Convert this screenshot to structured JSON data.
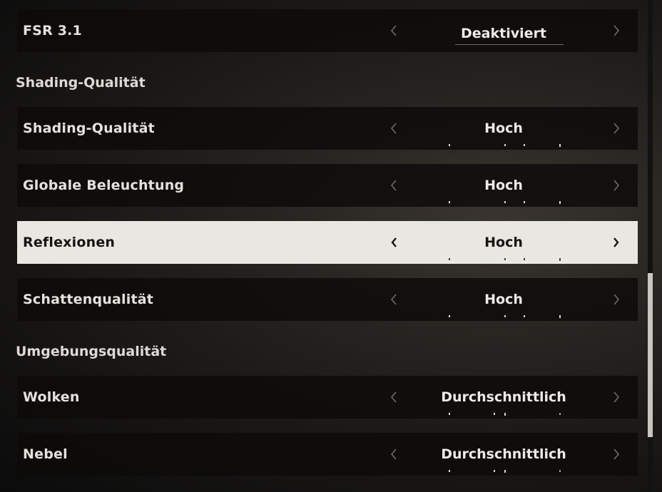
{
  "colors": {
    "row_bg": "#0c0b0a",
    "selected_bg": "#e9e7e1",
    "text": "#e4e2dc",
    "selected_text": "#151412",
    "scroll_thumb": "#c8c6c0"
  },
  "icons": {
    "prev": "chevron-left-icon",
    "next": "chevron-right-icon"
  },
  "rows": {
    "fsr": {
      "label": "FSR 3.1",
      "value": "Deaktiviert"
    },
    "shading": {
      "label": "Shading-Qualität",
      "value": "Hoch",
      "level": 3,
      "levels": 3
    },
    "gi": {
      "label": "Globale Beleuchtung",
      "value": "Hoch",
      "level": 3,
      "levels": 3
    },
    "reflections": {
      "label": "Reflexionen",
      "value": "Hoch",
      "level": 3,
      "levels": 3,
      "selected": true
    },
    "shadows": {
      "label": "Schattenqualität",
      "value": "Hoch",
      "level": 3,
      "levels": 3
    },
    "clouds": {
      "label": "Wolken",
      "value": "Durchschnittlich",
      "level": 2,
      "levels": 3
    },
    "fog": {
      "label": "Nebel",
      "value": "Durchschnittlich",
      "level": 2,
      "levels": 3
    }
  },
  "sections": {
    "shading": "Shading-Qualität",
    "environment": "Umgebungsqualität"
  },
  "scrollbar": {
    "position_fraction": 0.56
  }
}
